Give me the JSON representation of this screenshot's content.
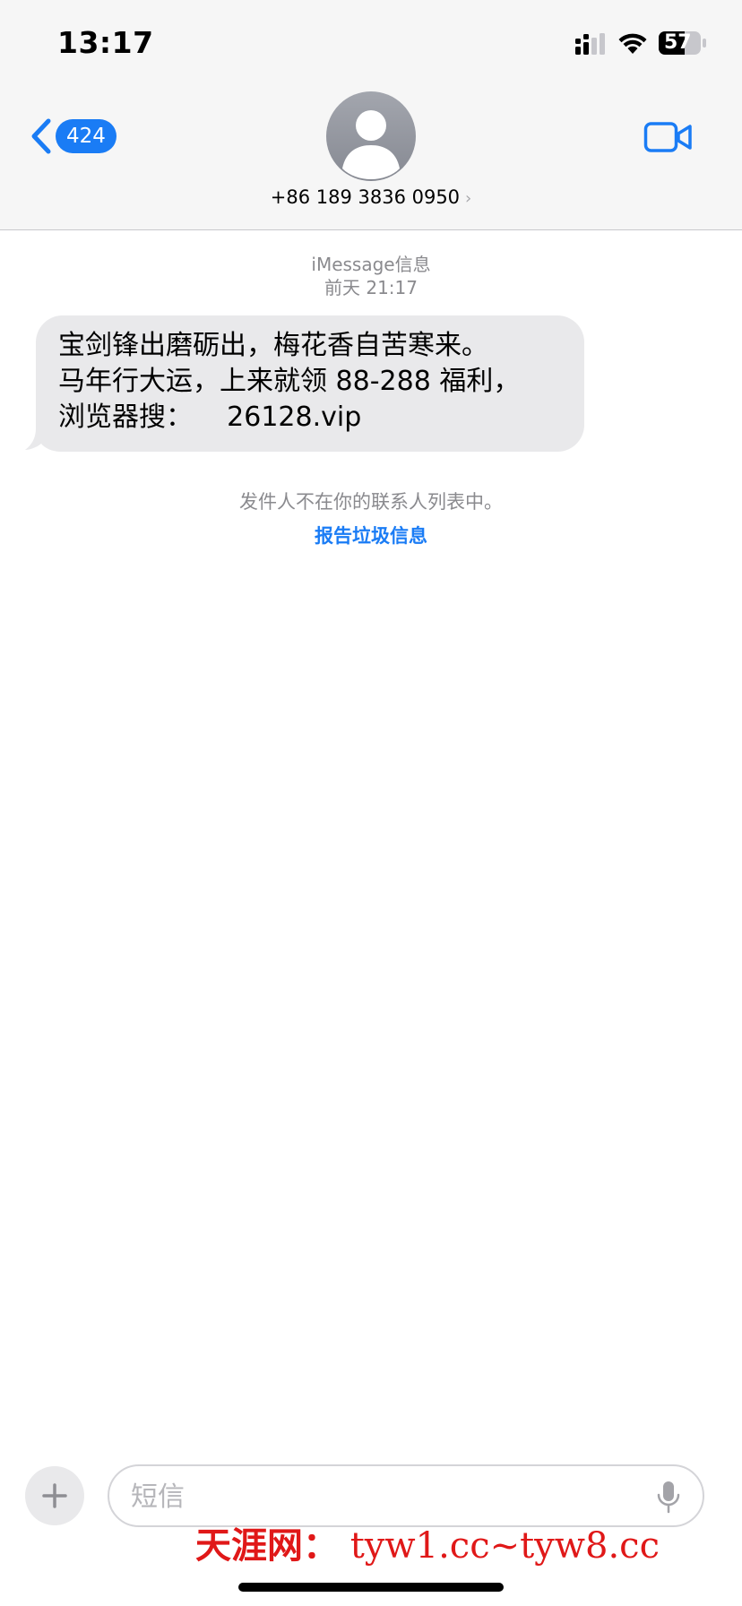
{
  "status_bar": {
    "time": "13:17",
    "battery": "57",
    "icons": [
      "cellular-signal-icon",
      "wifi-icon",
      "battery-icon"
    ]
  },
  "header": {
    "back_badge": "424",
    "contact": "+86 189 3836 0950",
    "contact_chevron": "›",
    "icons": [
      "back-chevron-icon",
      "avatar-person-icon",
      "video-camera-icon"
    ]
  },
  "thread": {
    "service": "iMessage信息",
    "timestamp": "前天 21:17",
    "messages": [
      {
        "direction": "incoming",
        "text": "宝剑锋出磨砺出，梅花香自苦寒来。\n马年行大运，上来就领 88-288 福利，\n浏览器搜：    26128.vip"
      }
    ],
    "not_in_contacts": "发件人不在你的联系人列表中。",
    "report_spam": "报告垃圾信息"
  },
  "compose": {
    "placeholder": "短信",
    "value": "",
    "icons": [
      "plus-icon",
      "microphone-icon"
    ]
  },
  "watermark": {
    "brand": "天涯网：",
    "urls": " tyw1.cc~tyw8.cc"
  },
  "colors": {
    "accent": "#1a7cf5",
    "header_bg": "#f6f6f6",
    "bubble_incoming": "#e9e9eb",
    "secondary_text": "#8a8a8e",
    "watermark": "#e01818"
  }
}
